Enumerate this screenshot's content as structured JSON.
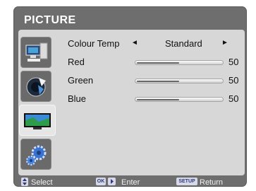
{
  "menu": {
    "title": "PICTURE"
  },
  "tabs": [
    {
      "icon": "computer-icon",
      "active": false
    },
    {
      "icon": "speaker-icon",
      "active": false
    },
    {
      "icon": "tv-screen-icon",
      "active": true
    },
    {
      "icon": "gears-icon",
      "active": false
    }
  ],
  "settings": {
    "colour_temp": {
      "label": "Colour Temp",
      "value": "Standard",
      "left_arrow": "◄",
      "right_arrow": "►"
    },
    "red": {
      "label": "Red",
      "value": 50
    },
    "green": {
      "label": "Green",
      "value": 50
    },
    "blue": {
      "label": "Blue",
      "value": 50
    }
  },
  "footer": {
    "select_label": "Select",
    "ok_key": "OK",
    "enter_label": "Enter",
    "setup_key": "SETUP",
    "return_label": "Return"
  },
  "colors": {
    "frame": "#6e6e6e",
    "panel": "#d7d7d7",
    "text": "#111111",
    "footer_key": "#d8d8e8"
  }
}
